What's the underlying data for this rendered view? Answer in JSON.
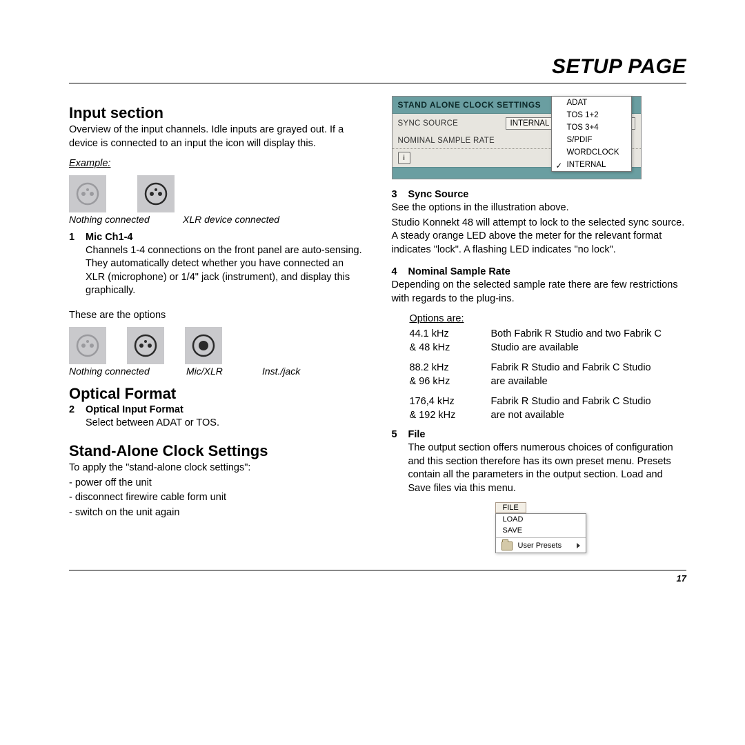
{
  "page_title": "SETUP PAGE",
  "page_number": "17",
  "left": {
    "h_input": "Input section",
    "input_p": "Overview of the input channels. Idle inputs are grayed out. If a device is connected to an input the icon will display this.",
    "example_label": "Example:",
    "cap_nothing": "Nothing connected",
    "cap_xlr": "XLR device connected",
    "mic_num": "1",
    "mic_title": "Mic Ch1-4",
    "mic_p": "Channels 1-4 connections on the front panel are auto-sensing. They automatically detect whether you have connected an XLR (microphone) or 1/4\" jack (instrument), and display this graphically.",
    "these_options": "These are the options",
    "cap_nothing2": "Nothing connected",
    "cap_micxlr": "Mic/XLR",
    "cap_instjack": "Inst./jack",
    "h_optical": "Optical Format",
    "opt_num": "2",
    "opt_title": "Optical Input Format",
    "opt_p": "Select between ADAT or TOS.",
    "h_clock": "Stand-Alone Clock Settings",
    "clock_p": "To apply the \"stand-alone clock settings\":",
    "clock_l1": "- power off the unit",
    "clock_l2": "- disconnect firewire cable form unit",
    "clock_l3": "- switch on the unit again"
  },
  "panel": {
    "header": "STAND ALONE CLOCK SETTINGS",
    "row1_label": "SYNC SOURCE",
    "row1_value": "INTERNAL",
    "row2_label": "NOMINAL SAMPLE RATE",
    "options": [
      "ADAT",
      "TOS 1+2",
      "TOS 3+4",
      "S/PDIF",
      "WORDCLOCK",
      "INTERNAL"
    ],
    "checked_index": 5
  },
  "right": {
    "sync_num": "3",
    "sync_title": "Sync Source",
    "sync_p1": "See the options in the illustration above.",
    "sync_p2": "Studio Konnekt 48 will attempt to lock to the selected sync source. A steady orange LED above the meter for the relevant format indicates \"lock\". A flashing LED indicates \"no lock\".",
    "nsr_num": "4",
    "nsr_title": "Nominal Sample Rate",
    "nsr_p": "Depending on the selected sample rate there are few restrictions with regards to the plug-ins.",
    "options_label": "Options are:",
    "opts": [
      {
        "l1": "44.1 kHz",
        "l2": "& 48 kHz",
        "r1": "Both Fabrik R Studio and two Fabrik C",
        "r2": "Studio are available"
      },
      {
        "l1": "88.2 kHz",
        "l2": "& 96 kHz",
        "r1": "Fabrik R Studio and Fabrik C Studio",
        "r2": "are available"
      },
      {
        "l1": "176,4 kHz",
        "l2": "& 192 kHz",
        "r1": "Fabrik R Studio and Fabrik C Studio",
        "r2": "are not available"
      }
    ],
    "file_num": "5",
    "file_title": "File",
    "file_p": "The output section offers numerous choices of configuration and this section therefore has its own preset menu. Presets contain all the parameters in the output section. Load and Save files via this menu."
  },
  "file_menu": {
    "button": "FILE",
    "load": "LOAD",
    "save": "SAVE",
    "user_presets": "User Presets"
  }
}
